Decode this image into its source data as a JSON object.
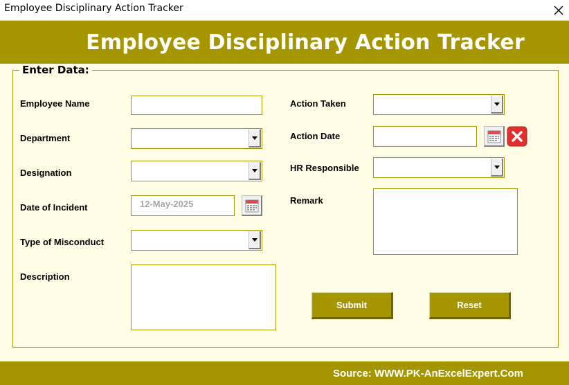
{
  "window": {
    "title": "Employee Disciplinary Action Tracker",
    "close_icon": "close-icon"
  },
  "header": {
    "title": "Employee Disciplinary Action Tracker"
  },
  "frame": {
    "legend": "Enter Data:"
  },
  "fields": {
    "employee_name": {
      "label": "Employee Name",
      "value": ""
    },
    "department": {
      "label": "Department",
      "value": ""
    },
    "designation": {
      "label": "Designation",
      "value": ""
    },
    "date_of_incident": {
      "label": "Date of Incident",
      "value": "12-May-2025"
    },
    "type_of_misconduct": {
      "label": "Type of Misconduct",
      "value": ""
    },
    "description": {
      "label": "Description",
      "value": ""
    },
    "action_taken": {
      "label": "Action Taken",
      "value": ""
    },
    "action_date": {
      "label": "Action Date",
      "value": ""
    },
    "hr_responsible": {
      "label": "HR Responsible",
      "value": ""
    },
    "remark": {
      "label": "Remark",
      "value": ""
    }
  },
  "buttons": {
    "submit": "Submit",
    "reset": "Reset"
  },
  "footer": {
    "source": "Source: WWW.PK-AnExcelExpert.Com"
  },
  "colors": {
    "accent": "#A59600",
    "background": "#FFFDE6",
    "clear_red": "#E03030"
  }
}
